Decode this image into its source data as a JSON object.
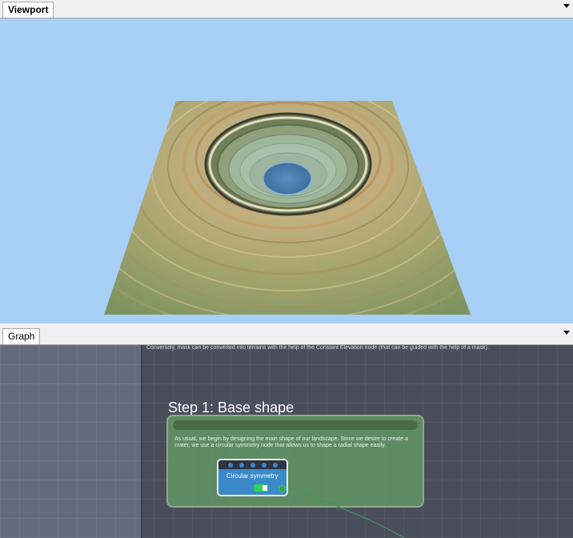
{
  "viewport_panel": {
    "tab_label": "Viewport"
  },
  "graph_panel": {
    "tab_label": "Graph",
    "top_note": "Conversely, mask can be converted into terrains with the help of the Constant Elevation node (that can be guided with the help of a mask).",
    "step_title": "Step 1: Base shape",
    "frame_description": "As usual, we begin by designing the main shape of our landscape. Since we desire to create a crater, we use a circular symmetry node that allows us to shape a radial shape easily.",
    "node": {
      "title": "Circular symmetry",
      "input_port_count": 5
    }
  },
  "colors": {
    "viewport_bg": "#a8cff5",
    "graph_bg": "#4a4e5c",
    "node_blue": "#3a8ac9",
    "frame_green": "#64a064",
    "toggle_green": "#2fd15a"
  }
}
